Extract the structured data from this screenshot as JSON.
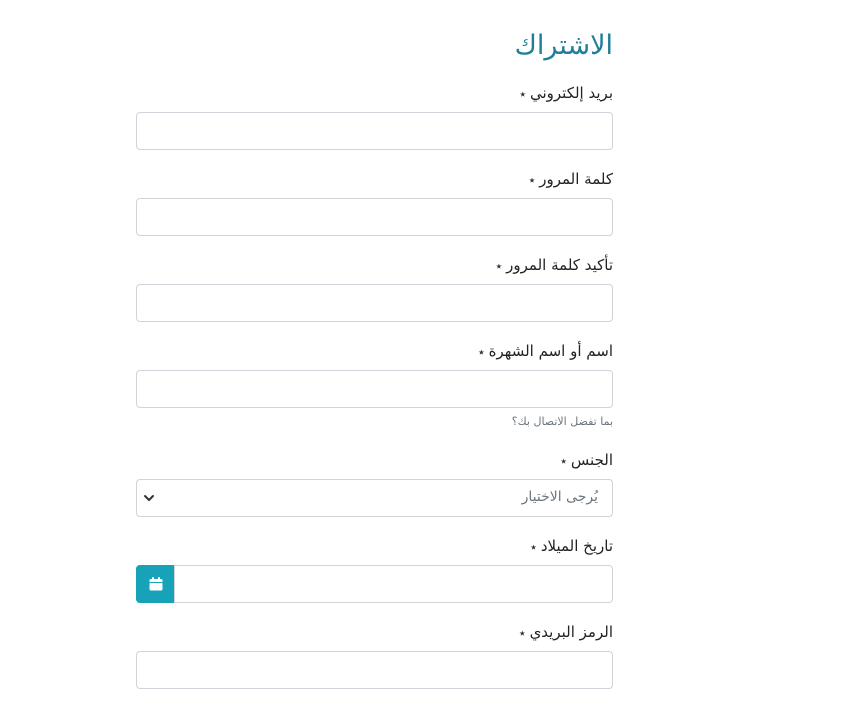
{
  "form": {
    "title": "الاشتراك",
    "required_marker": "٭",
    "fields": {
      "email": {
        "label": "بريد إلكتروني"
      },
      "password": {
        "label": "كلمة المرور"
      },
      "confirm_password": {
        "label": "تأكيد كلمة المرور"
      },
      "display_name": {
        "label": "اسم أو اسم الشهرة",
        "help": "بما تفضل الاتصال بك؟"
      },
      "gender": {
        "label": "الجنس",
        "selected": "يُرجى الاختيار"
      },
      "birthdate": {
        "label": "تاريخ الميلاد"
      },
      "postal_code": {
        "label": "الرمز البريدي"
      }
    }
  },
  "icons": {
    "calendar": "calendar-icon",
    "chevron": "chevron-down-icon"
  },
  "colors": {
    "title": "#1f7f99",
    "accent": "#17a2b8",
    "border": "#ced4da",
    "muted": "#6c757d"
  }
}
